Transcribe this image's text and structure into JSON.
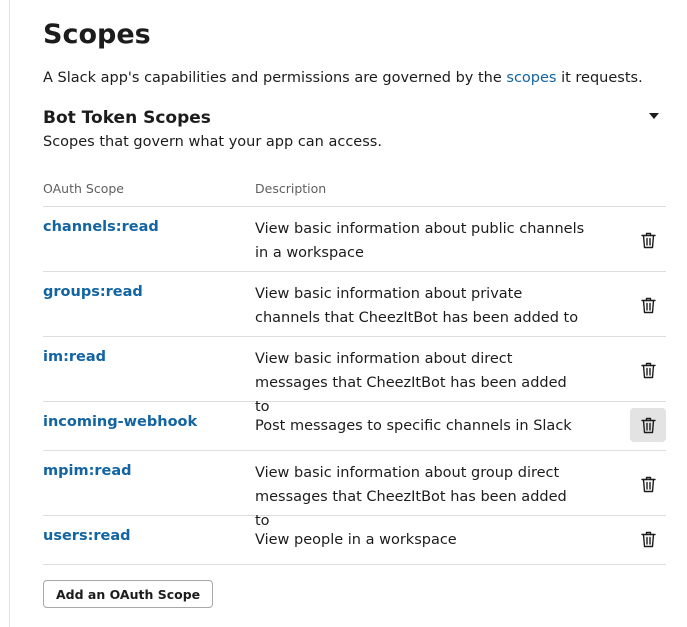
{
  "header": {
    "title": "Scopes",
    "intro_before": "A Slack app's capabilities and permissions are governed by the ",
    "intro_link": "scopes",
    "intro_after": " it requests."
  },
  "section": {
    "title": "Bot Token Scopes",
    "subtitle": "Scopes that govern what your app can access.",
    "toggle_icon": "caret-down-icon"
  },
  "table": {
    "columns": [
      "OAuth Scope",
      "Description"
    ],
    "rows": [
      {
        "scope": "channels:read",
        "description": "View basic information about public channels in a workspace"
      },
      {
        "scope": "groups:read",
        "description": "View basic information about private channels that CheezItBot has been added to"
      },
      {
        "scope": "im:read",
        "description": "View basic information about direct messages that CheezItBot has been added to"
      },
      {
        "scope": "incoming-webhook",
        "description": "Post messages to specific channels in Slack"
      },
      {
        "scope": "mpim:read",
        "description": "View basic information about group direct messages that CheezItBot has been added to"
      },
      {
        "scope": "users:read",
        "description": "View people in a workspace"
      }
    ],
    "row_action_icon": "trash-icon"
  },
  "actions": {
    "add_scope_label": "Add an OAuth Scope"
  },
  "colors": {
    "link": "#1264a3",
    "text": "#1d1c1d",
    "muted": "#616061",
    "divider": "#dddddd",
    "hover": "#e3e3e3"
  }
}
